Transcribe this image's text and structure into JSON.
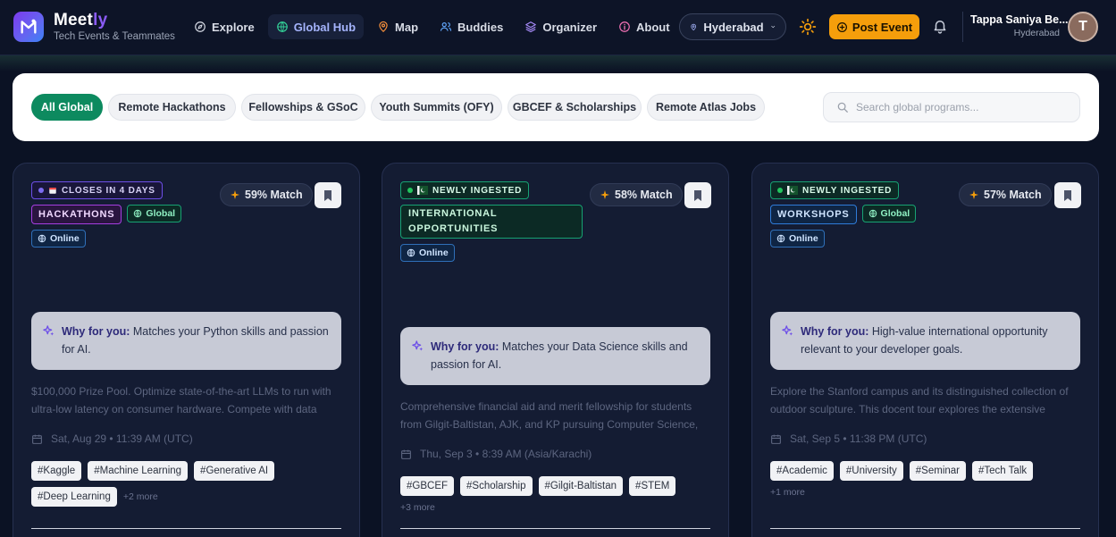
{
  "brand": {
    "name_main": "Meet",
    "name_accent": "ly",
    "tagline": "Tech Events & Teammates"
  },
  "nav": {
    "links": [
      {
        "label": "Explore",
        "icon": "compass-icon"
      },
      {
        "label": "Global Hub",
        "icon": "globe-icon",
        "active": true
      },
      {
        "label": "Map",
        "icon": "map-pin-icon"
      },
      {
        "label": "Buddies",
        "icon": "users-icon"
      },
      {
        "label": "Organizer",
        "icon": "layers-icon"
      },
      {
        "label": "About",
        "icon": "info-icon"
      }
    ],
    "city": "Hyderabad",
    "post_event": "Post Event",
    "user": {
      "name": "Tappa Saniya Be...",
      "city": "Hyderabad",
      "initial": "T"
    }
  },
  "filters": {
    "chips": [
      "All Global",
      "Remote Hackathons",
      "Fellowships & GSoC",
      "Youth Summits (OFY)",
      "GBCEF & Scholarships",
      "Remote Atlas Jobs"
    ],
    "active_index": 0,
    "search_placeholder": "Search global programs..."
  },
  "cards": [
    {
      "status": "CLOSES IN 4 DAYS",
      "category": "HACKATHONS",
      "global": "Global",
      "mode": "Online",
      "match": "59% Match",
      "why_label": "Why for you:",
      "why_text": "Matches your Python skills and passion for AI.",
      "description": "$100,000 Prize Pool. Optimize state-of-the-art LLMs to run with ultra-low latency on consumer hardware. Compete with data scientists worldwide.",
      "date": "Sat, Aug 29 • 11:39 AM (UTC)",
      "tags": [
        "#Kaggle",
        "#Machine Learning",
        "#Generative AI",
        "#Deep Learning"
      ],
      "more": "+2 more"
    },
    {
      "status": "NEWLY INGESTED",
      "category": "INTERNATIONAL OPPORTUNITIES",
      "mode": "Online",
      "match": "58% Match",
      "why_label": "Why for you:",
      "why_text": "Matches your Data Science skills and passion for AI.",
      "description": "Comprehensive financial aid and merit fellowship for students from Gilgit-Baltistan, AJK, and KP pursuing Computer Science, Engineering and related fields.",
      "date": "Thu, Sep 3 • 8:39 AM (Asia/Karachi)",
      "tags": [
        "#GBCEF",
        "#Scholarship",
        "#Gilgit-Baltistan",
        "#STEM"
      ],
      "more": "+3 more"
    },
    {
      "status": "NEWLY INGESTED",
      "category": "WORKSHOPS",
      "global": "Global",
      "mode": "Online",
      "match": "57% Match",
      "why_label": "Why for you:",
      "why_text": "High-value international opportunity relevant to your developer goals.",
      "description": "Explore the Stanford campus and its distinguished collection of outdoor sculpture. This docent tour explores the extensive collection across the grounds.",
      "date": "Sat, Sep 5 • 11:38 PM (UTC)",
      "tags": [
        "#Academic",
        "#University",
        "#Seminar",
        "#Tech Talk"
      ],
      "more": "+1 more"
    }
  ],
  "colors": {
    "background": "#0b1224",
    "accent_green": "#0d8a5f",
    "accent_orange": "#f59e0b",
    "accent_purple": "#8b5cf6"
  }
}
